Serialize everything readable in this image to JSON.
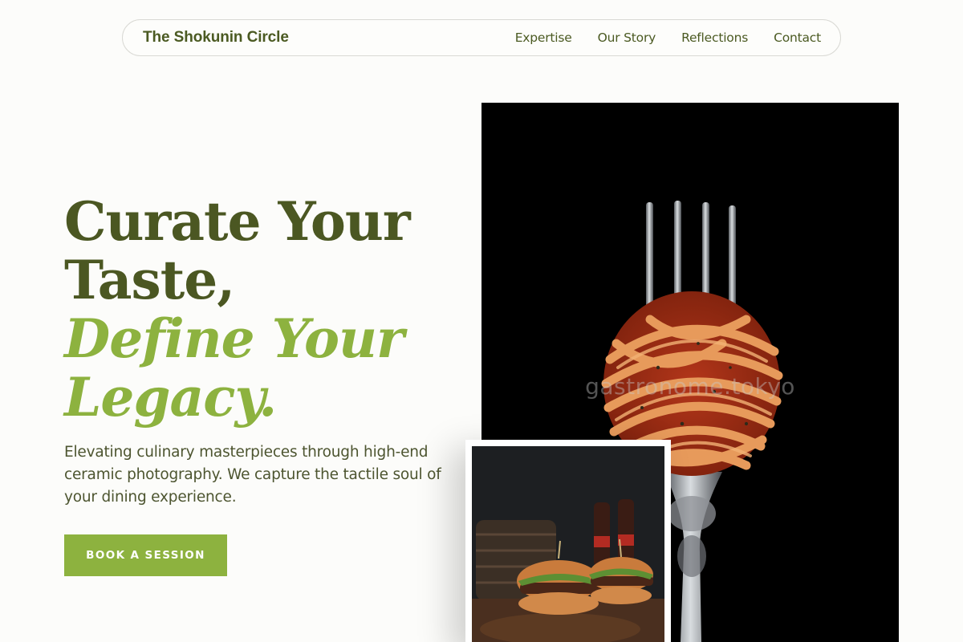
{
  "nav": {
    "brand": "The Shokunin Circle",
    "links": [
      "Expertise",
      "Our Story",
      "Reflections",
      "Contact"
    ]
  },
  "hero": {
    "headline_line1": "Curate Your",
    "headline_line2": "Taste,",
    "headline_accent_line1": "Define Your",
    "headline_accent_line2": "Legacy.",
    "subtitle": "Elevating culinary masterpieces through high-end ceramic photography. We capture the tactile soul of your dining experience.",
    "cta_label": "BOOK A SESSION"
  },
  "images": {
    "main_alt": "pasta-on-fork-photo",
    "main_watermark": "gastronome.tokyo",
    "inset_alt": "burgers-photo"
  },
  "colors": {
    "primary": "#4b5722",
    "accent": "#8db23f",
    "background": "#fcfcfa"
  }
}
